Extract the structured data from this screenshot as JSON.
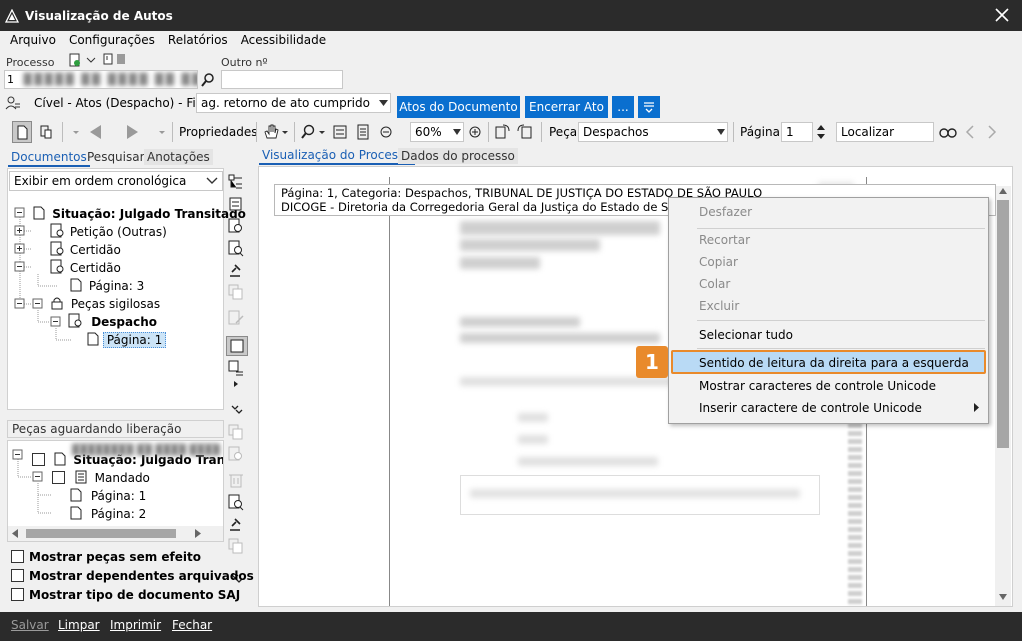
{
  "window": {
    "title": "Visualização de Autos"
  },
  "menu": [
    "Arquivo",
    "Configurações",
    "Relatórios",
    "Acessibilidade"
  ],
  "header": {
    "processo_label": "Processo",
    "processo_value": "1",
    "outro_label": "Outro nº",
    "outro_value": ""
  },
  "fila": {
    "label": "Cível - Atos (Despacho) - Fila:",
    "value": "ag. retorno de ato cumprido",
    "btn_atos": "Atos do Documento",
    "btn_encerrar": "Encerrar Ato",
    "btn_more": "..."
  },
  "toolbar": {
    "propriedades": "Propriedades",
    "zoom": "60%",
    "peca_label": "Peça",
    "peca_value": "Despachos",
    "pagina_label": "Página",
    "pagina_value": "1",
    "localizar": "Localizar"
  },
  "left_tabs": [
    "Documentos",
    "Pesquisar",
    "Anotações"
  ],
  "order_combo": "Exibir em ordem cronológica",
  "tree": {
    "situacao": "Situação: Julgado Transitado",
    "items": [
      "Petição (Outras)",
      "Certidão",
      "Certidão",
      "Página: 3",
      "Peças sigilosas",
      "Despacho",
      "Página: 1"
    ]
  },
  "pending": {
    "header": "Peças aguardando liberação",
    "situacao": "Situação: Julgado Transita",
    "items": [
      "Mandado",
      "Página: 1",
      "Página: 2"
    ]
  },
  "checkboxes": [
    "Mostrar peças sem efeito",
    "Mostrar dependentes arquivados",
    "Mostrar tipo de documento SAJ"
  ],
  "right_tabs": [
    "Visualização do Processo",
    "Dados do processo"
  ],
  "tooltip": {
    "line1": "Página: 1, Categoria: Despachos, TRIBUNAL DE JUSTIÇA DO ESTADO DE SÃO PAULO",
    "line2": "DICOGE - Diretoria da Corregedoria Geral da Justiça do Estado de São"
  },
  "context_menu": {
    "desfazer": "Desfazer",
    "recortar": "Recortar",
    "copiar": "Copiar",
    "colar": "Colar",
    "excluir": "Excluir",
    "selecionar": "Selecionar tudo",
    "sentido": "Sentido de leitura da direita para a esquerda",
    "mostrar": "Mostrar caracteres de controle Unicode",
    "inserir": "Inserir caractere de controle Unicode"
  },
  "badge": "1",
  "bottom": [
    "Salvar",
    "Limpar",
    "Imprimir",
    "Fechar"
  ]
}
